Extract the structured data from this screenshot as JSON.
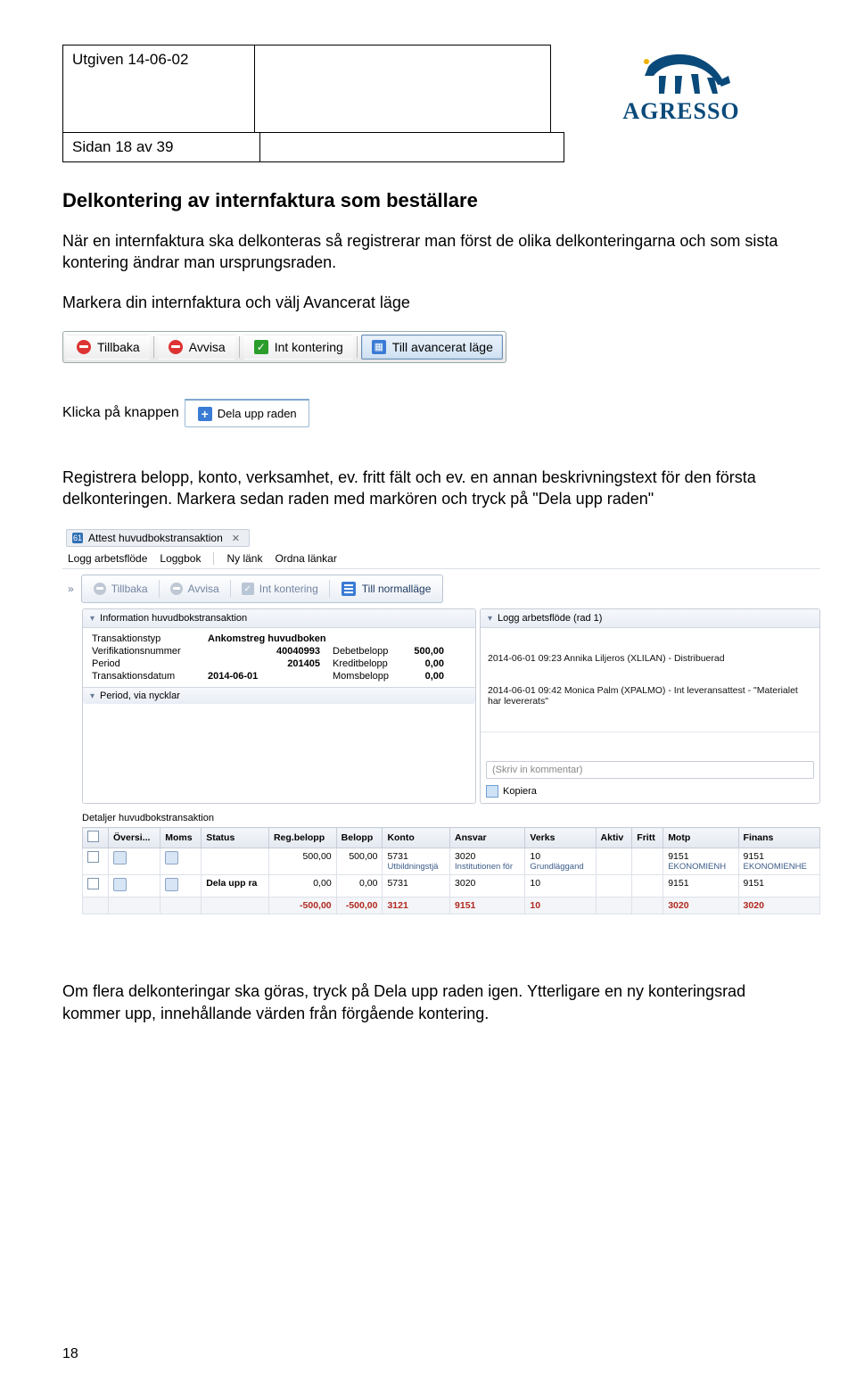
{
  "header": {
    "issued": "Utgiven 14-06-02",
    "page_of": "Sidan 18 av 39",
    "logo_text": "AGRESSO"
  },
  "section_title": "Delkontering av internfaktura som beställare",
  "para1": "När en internfaktura ska delkonteras så registrerar man först de olika delkonteringarna och som sista kontering ändrar man ursprungsraden.",
  "para2": "Markera din internfaktura och välj Avancerat läge",
  "toolbar1": {
    "tillbaka": "Tillbaka",
    "avvisa": "Avvisa",
    "intkont": "Int kontering",
    "till_av": "Till avancerat läge"
  },
  "klicka_prefix": "Klicka på knappen",
  "dela_upp_chip": "Dela upp raden",
  "para3": "Registrera belopp, konto, verksamhet, ev. fritt fält och ev. en annan beskrivningstext för den första delkonteringen. Markera sedan raden med markören och tryck på \"Dela upp raden\"",
  "app": {
    "tab_title": "Attest huvudbokstransaktion",
    "menu": {
      "logg": "Logg arbetsflöde",
      "loggbok": "Loggbok",
      "nylank": "Ny länk",
      "ordna": "Ordna länkar"
    },
    "toolbar": {
      "tillbaka": "Tillbaka",
      "avvisa": "Avvisa",
      "intkont": "Int kontering",
      "tillnorm": "Till normalläge"
    },
    "info_hd": "Information huvudbokstransaktion",
    "info": {
      "r1l": "Transaktionstyp",
      "r1v": "Ankomstreg huvudboken",
      "r2l": "Verifikationsnummer",
      "r2v": "40040993",
      "r2l2": "Debetbelopp",
      "r2v2": "500,00",
      "r3l": "Period",
      "r3v": "201405",
      "r3l2": "Kreditbelopp",
      "r3v2": "0,00",
      "r4l": "Transaktionsdatum",
      "r4v": "2014-06-01",
      "r4l2": "Momsbelopp",
      "r4v2": "0,00"
    },
    "period_bar": "Period, via nycklar",
    "log_hd": "Logg arbetsflöde (rad 1)",
    "log_line1": "2014-06-01 09:23 Annika Liljeros (XLILAN) - Distribuerad",
    "log_line2": "2014-06-01 09:42 Monica Palm (XPALMO) - Int leveransattest - \"Materialet har levererats\"",
    "comment_placeholder": "(Skriv in kommentar)",
    "kopiera": "Kopiera",
    "details_hd": "Detaljer huvudbokstransaktion",
    "cols": {
      "oversi": "Översi...",
      "moms": "Moms",
      "status": "Status",
      "regbel": "Reg.belopp",
      "belopp": "Belopp",
      "konto": "Konto",
      "ansvar": "Ansvar",
      "verks": "Verks",
      "aktiv": "Aktiv",
      "fritt": "Fritt",
      "motp": "Motp",
      "finans": "Finans"
    },
    "rows": [
      {
        "status": "",
        "reg": "500,00",
        "bel": "500,00",
        "konto": "5731",
        "konto_sub": "Utbildningstjä",
        "ansvar": "3020",
        "ansvar_sub": "Institutionen för",
        "verks": "10",
        "verks_sub": "Grundläggand",
        "aktiv": "",
        "fritt": "",
        "motp": "9151",
        "motp_sub": "EKONOMIENH",
        "finans": "9151",
        "finans_sub": "EKONOMIENHE"
      },
      {
        "status": "Dela upp ra",
        "reg": "0,00",
        "bel": "0,00",
        "konto": "5731",
        "ansvar": "3020",
        "verks": "10",
        "aktiv": "",
        "fritt": "",
        "motp": "9151",
        "finans": "9151"
      },
      {
        "total": true,
        "reg": "-500,00",
        "bel": "-500,00",
        "konto": "3121",
        "ansvar": "9151",
        "verks": "10",
        "aktiv": "",
        "fritt": "",
        "motp": "3020",
        "finans": "3020"
      }
    ]
  },
  "para4": "Om flera delkonteringar ska göras, tryck på Dela upp raden igen. Ytterligare en ny konteringsrad kommer upp, innehållande värden från förgående kontering.",
  "pagenum": "18"
}
